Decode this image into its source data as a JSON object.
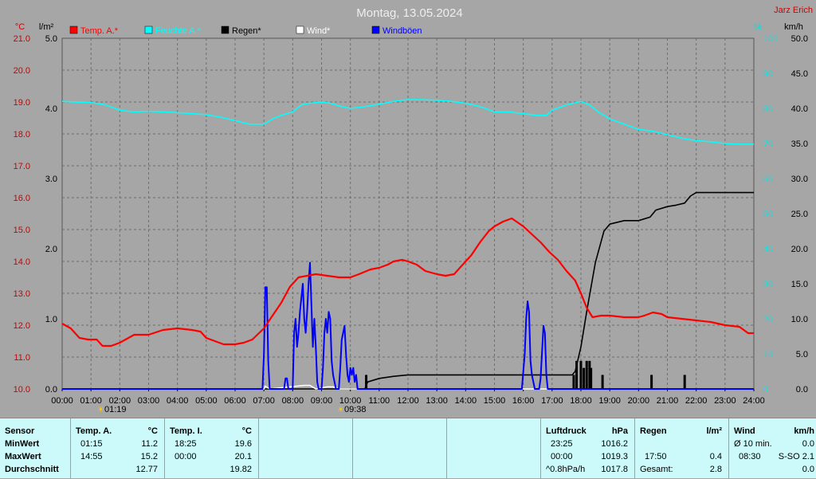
{
  "title": "Montag, 13.05.2024",
  "author": "Jarz Erich",
  "axes": {
    "temp_unit": "°C",
    "rain_unit": "l/m²",
    "humidity_unit": "%",
    "wind_unit": "km/h",
    "temp_ticks": [
      "21.0",
      "20.0",
      "19.0",
      "18.0",
      "17.0",
      "16.0",
      "15.0",
      "14.0",
      "13.0",
      "12.0",
      "11.0",
      "10.0"
    ],
    "rain_ticks": [
      "5.0",
      "4.0",
      "3.0",
      "2.0",
      "1.0",
      "0.0"
    ],
    "humidity_ticks": [
      "100",
      "90",
      "80",
      "70",
      "60",
      "50",
      "40",
      "30",
      "20",
      "10",
      "0"
    ],
    "wind_ticks": [
      "50.0",
      "45.0",
      "40.0",
      "35.0",
      "30.0",
      "25.0",
      "20.0",
      "15.0",
      "10.0",
      "5.0",
      "0.0"
    ],
    "time_ticks": [
      "00:00",
      "01:00",
      "02:00",
      "03:00",
      "04:00",
      "05:00",
      "06:00",
      "07:00",
      "08:00",
      "09:00",
      "10:00",
      "11:00",
      "12:00",
      "13:00",
      "14:00",
      "15:00",
      "16:00",
      "17:00",
      "18:00",
      "19:00",
      "20:00",
      "21:00",
      "22:00",
      "23:00",
      "24:00"
    ],
    "sunrise": "01:19",
    "sunset": "09:38"
  },
  "legend": [
    {
      "label": "Temp. A.*",
      "color": "#ff0000"
    },
    {
      "label": "Feuchte A.*",
      "color": "#00ffff"
    },
    {
      "label": "Regen*",
      "color": "#000000"
    },
    {
      "label": "Wind*",
      "color": "#ffffff"
    },
    {
      "label": "Windböen",
      "color": "#0000ff"
    }
  ],
  "chart_data": {
    "type": "line",
    "x_unit": "hours",
    "xlim": [
      0,
      24
    ],
    "series": [
      {
        "name": "Temp. A.*",
        "axis": "temp",
        "ylim": [
          10,
          21
        ],
        "color": "#ff0000",
        "points": [
          [
            0,
            12.05
          ],
          [
            0.3,
            11.9
          ],
          [
            0.6,
            11.6
          ],
          [
            0.9,
            11.55
          ],
          [
            1.2,
            11.55
          ],
          [
            1.4,
            11.35
          ],
          [
            1.7,
            11.35
          ],
          [
            2.0,
            11.45
          ],
          [
            2.3,
            11.6
          ],
          [
            2.5,
            11.7
          ],
          [
            3.0,
            11.7
          ],
          [
            3.5,
            11.85
          ],
          [
            4.0,
            11.9
          ],
          [
            4.5,
            11.85
          ],
          [
            4.8,
            11.8
          ],
          [
            5.0,
            11.6
          ],
          [
            5.3,
            11.5
          ],
          [
            5.6,
            11.4
          ],
          [
            6.0,
            11.4
          ],
          [
            6.3,
            11.45
          ],
          [
            6.6,
            11.55
          ],
          [
            7.0,
            11.9
          ],
          [
            7.3,
            12.3
          ],
          [
            7.6,
            12.7
          ],
          [
            7.9,
            13.2
          ],
          [
            8.2,
            13.5
          ],
          [
            8.5,
            13.55
          ],
          [
            8.8,
            13.6
          ],
          [
            9.2,
            13.55
          ],
          [
            9.6,
            13.5
          ],
          [
            10.0,
            13.5
          ],
          [
            10.3,
            13.6
          ],
          [
            10.7,
            13.75
          ],
          [
            11.0,
            13.8
          ],
          [
            11.3,
            13.9
          ],
          [
            11.5,
            14.0
          ],
          [
            11.8,
            14.05
          ],
          [
            12.0,
            14.0
          ],
          [
            12.3,
            13.9
          ],
          [
            12.6,
            13.7
          ],
          [
            13.0,
            13.6
          ],
          [
            13.3,
            13.55
          ],
          [
            13.6,
            13.6
          ],
          [
            13.9,
            13.9
          ],
          [
            14.2,
            14.2
          ],
          [
            14.5,
            14.6
          ],
          [
            14.8,
            14.95
          ],
          [
            15.0,
            15.1
          ],
          [
            15.3,
            15.25
          ],
          [
            15.6,
            15.35
          ],
          [
            16.0,
            15.1
          ],
          [
            16.3,
            14.85
          ],
          [
            16.6,
            14.6
          ],
          [
            16.9,
            14.3
          ],
          [
            17.2,
            14.05
          ],
          [
            17.5,
            13.7
          ],
          [
            17.8,
            13.4
          ],
          [
            18.0,
            13.0
          ],
          [
            18.2,
            12.55
          ],
          [
            18.4,
            12.25
          ],
          [
            18.7,
            12.3
          ],
          [
            19.0,
            12.3
          ],
          [
            19.5,
            12.25
          ],
          [
            20.0,
            12.25
          ],
          [
            20.2,
            12.3
          ],
          [
            20.5,
            12.4
          ],
          [
            20.8,
            12.35
          ],
          [
            21.0,
            12.25
          ],
          [
            21.5,
            12.2
          ],
          [
            22.0,
            12.15
          ],
          [
            22.5,
            12.1
          ],
          [
            23.0,
            12.0
          ],
          [
            23.5,
            11.95
          ],
          [
            23.8,
            11.75
          ],
          [
            24.0,
            11.75
          ]
        ]
      },
      {
        "name": "Feuchte A.*",
        "axis": "humidity",
        "ylim": [
          0,
          100
        ],
        "color": "#00ffff",
        "points": [
          [
            0,
            82.0
          ],
          [
            0.5,
            81.8
          ],
          [
            1.0,
            81.7
          ],
          [
            1.5,
            81.0
          ],
          [
            2.0,
            79.5
          ],
          [
            2.5,
            79.0
          ],
          [
            3.0,
            79.2
          ],
          [
            3.5,
            79.0
          ],
          [
            4.0,
            78.8
          ],
          [
            4.5,
            78.5
          ],
          [
            5.0,
            78.2
          ],
          [
            5.5,
            77.5
          ],
          [
            6.0,
            76.5
          ],
          [
            6.5,
            75.5
          ],
          [
            7.0,
            75.5
          ],
          [
            7.3,
            77.0
          ],
          [
            7.6,
            78.0
          ],
          [
            8.0,
            79.0
          ],
          [
            8.3,
            81.0
          ],
          [
            8.6,
            81.5
          ],
          [
            9.0,
            81.8
          ],
          [
            9.3,
            81.5
          ],
          [
            9.7,
            80.5
          ],
          [
            10.0,
            80.0
          ],
          [
            10.5,
            80.5
          ],
          [
            11.0,
            81.2
          ],
          [
            11.5,
            82.0
          ],
          [
            12.0,
            82.5
          ],
          [
            12.5,
            82.5
          ],
          [
            13.0,
            82.3
          ],
          [
            13.5,
            82.0
          ],
          [
            14.0,
            81.5
          ],
          [
            14.5,
            80.5
          ],
          [
            15.0,
            79.0
          ],
          [
            15.5,
            79.0
          ],
          [
            16.0,
            78.5
          ],
          [
            16.5,
            78.0
          ],
          [
            16.8,
            78.0
          ],
          [
            17.0,
            79.5
          ],
          [
            17.5,
            81.0
          ],
          [
            18.0,
            82.0
          ],
          [
            18.3,
            81.0
          ],
          [
            18.6,
            79.0
          ],
          [
            19.0,
            77.0
          ],
          [
            19.5,
            75.5
          ],
          [
            20.0,
            74.0
          ],
          [
            20.5,
            73.5
          ],
          [
            21.0,
            72.5
          ],
          [
            21.5,
            71.5
          ],
          [
            22.0,
            70.8
          ],
          [
            22.5,
            70.5
          ],
          [
            23.0,
            70.0
          ],
          [
            23.5,
            69.8
          ],
          [
            24.0,
            69.8
          ]
        ]
      },
      {
        "name": "Regen*",
        "axis": "rain",
        "ylim": [
          0,
          5
        ],
        "color": "#000000",
        "points": [
          [
            0,
            0
          ],
          [
            10.5,
            0
          ],
          [
            10.6,
            0.1
          ],
          [
            11.0,
            0.15
          ],
          [
            11.5,
            0.18
          ],
          [
            12.0,
            0.2
          ],
          [
            17.2,
            0.2
          ],
          [
            17.7,
            0.2
          ],
          [
            17.8,
            0.25
          ],
          [
            18.0,
            0.6
          ],
          [
            18.2,
            1.1
          ],
          [
            18.5,
            1.8
          ],
          [
            18.8,
            2.25
          ],
          [
            19.0,
            2.35
          ],
          [
            19.5,
            2.4
          ],
          [
            20.0,
            2.4
          ],
          [
            20.4,
            2.45
          ],
          [
            20.6,
            2.55
          ],
          [
            21.0,
            2.6
          ],
          [
            21.3,
            2.62
          ],
          [
            21.6,
            2.65
          ],
          [
            21.8,
            2.75
          ],
          [
            22.0,
            2.8
          ],
          [
            22.5,
            2.8
          ],
          [
            23.0,
            2.8
          ],
          [
            24.0,
            2.8
          ]
        ]
      },
      {
        "name": "Regen-Balken",
        "axis": "rain",
        "ylim": [
          0,
          5
        ],
        "color": "#000000",
        "bars": [
          [
            10.55,
            0.2
          ],
          [
            17.75,
            0.2
          ],
          [
            17.85,
            0.4
          ],
          [
            18.0,
            0.4
          ],
          [
            18.1,
            0.3
          ],
          [
            18.2,
            0.4
          ],
          [
            18.3,
            0.4
          ],
          [
            18.35,
            0.3
          ],
          [
            18.75,
            0.2
          ],
          [
            20.45,
            0.2
          ],
          [
            21.6,
            0.2
          ]
        ]
      },
      {
        "name": "Windböen",
        "axis": "wind",
        "ylim": [
          0,
          50
        ],
        "color": "#0000ff",
        "points": [
          [
            0,
            0
          ],
          [
            6.95,
            0
          ],
          [
            7.0,
            5
          ],
          [
            7.05,
            14.5
          ],
          [
            7.1,
            14.5
          ],
          [
            7.15,
            4
          ],
          [
            7.2,
            0
          ],
          [
            7.7,
            0
          ],
          [
            7.75,
            1.5
          ],
          [
            7.8,
            1.5
          ],
          [
            7.85,
            0
          ],
          [
            8.0,
            0
          ],
          [
            8.05,
            8
          ],
          [
            8.1,
            10
          ],
          [
            8.15,
            6
          ],
          [
            8.2,
            8
          ],
          [
            8.25,
            11
          ],
          [
            8.3,
            13
          ],
          [
            8.35,
            15
          ],
          [
            8.4,
            10
          ],
          [
            8.45,
            8
          ],
          [
            8.5,
            11
          ],
          [
            8.55,
            15
          ],
          [
            8.6,
            18
          ],
          [
            8.65,
            12
          ],
          [
            8.7,
            6
          ],
          [
            8.75,
            10
          ],
          [
            8.8,
            6
          ],
          [
            8.85,
            1
          ],
          [
            8.9,
            0
          ],
          [
            9.0,
            0
          ],
          [
            9.05,
            3
          ],
          [
            9.1,
            8
          ],
          [
            9.15,
            10
          ],
          [
            9.2,
            8
          ],
          [
            9.25,
            11
          ],
          [
            9.3,
            10
          ],
          [
            9.35,
            4
          ],
          [
            9.4,
            2
          ],
          [
            9.45,
            1
          ],
          [
            9.5,
            0
          ],
          [
            9.6,
            0
          ],
          [
            9.65,
            3
          ],
          [
            9.7,
            7
          ],
          [
            9.75,
            8
          ],
          [
            9.8,
            9
          ],
          [
            9.85,
            5
          ],
          [
            9.9,
            2
          ],
          [
            9.95,
            1
          ],
          [
            10.0,
            3
          ],
          [
            10.05,
            2
          ],
          [
            10.1,
            3
          ],
          [
            10.15,
            1
          ],
          [
            10.2,
            2
          ],
          [
            10.25,
            0
          ],
          [
            15.95,
            0
          ],
          [
            16.05,
            5
          ],
          [
            16.1,
            10
          ],
          [
            16.15,
            12.5
          ],
          [
            16.2,
            11
          ],
          [
            16.25,
            4
          ],
          [
            16.3,
            2
          ],
          [
            16.35,
            1
          ],
          [
            16.4,
            0
          ],
          [
            16.55,
            0
          ],
          [
            16.6,
            1.5
          ],
          [
            16.7,
            9
          ],
          [
            16.75,
            8
          ],
          [
            16.8,
            2
          ],
          [
            16.85,
            0
          ],
          [
            24.0,
            0
          ]
        ]
      },
      {
        "name": "Wind*",
        "axis": "wind",
        "ylim": [
          0,
          50
        ],
        "color": "#ffffff",
        "points": [
          [
            0,
            0
          ],
          [
            7.0,
            0
          ],
          [
            7.05,
            0.4
          ],
          [
            7.2,
            0
          ],
          [
            8.4,
            0.5
          ],
          [
            8.6,
            0.5
          ],
          [
            8.8,
            0
          ],
          [
            9.2,
            0.3
          ],
          [
            9.4,
            0.3
          ],
          [
            9.6,
            0
          ],
          [
            24,
            0
          ]
        ]
      }
    ]
  },
  "panel": {
    "sensor": {
      "header": "Sensor",
      "rows": [
        "MinWert",
        "MaxWert",
        "Durchschnitt"
      ]
    },
    "temp_a": {
      "header": "Temp. A.",
      "unit": "°C",
      "rows": [
        [
          "01:15",
          "11.2"
        ],
        [
          "14:55",
          "15.2"
        ],
        [
          "",
          "12.77"
        ]
      ]
    },
    "temp_i": {
      "header": "Temp. I.",
      "unit": "°C",
      "rows": [
        [
          "18:25",
          "19.6"
        ],
        [
          "00:00",
          "20.1"
        ],
        [
          "",
          "19.82"
        ]
      ]
    },
    "druck": {
      "header": "Luftdruck",
      "unit": "hPa",
      "rows": [
        [
          "23:25",
          "1016.2"
        ],
        [
          "00:00",
          "1019.3"
        ],
        [
          "^0.8hPa/h",
          "1017.8"
        ]
      ]
    },
    "regen": {
      "header": "Regen",
      "unit": "l/m²",
      "rows": [
        [
          "",
          ""
        ],
        [
          "17:50",
          "0.4"
        ],
        [
          "Gesamt:",
          "2.8"
        ]
      ]
    },
    "wind": {
      "header": "Wind",
      "unit": "km/h",
      "rows": [
        [
          "Ø 10 min.",
          "0.0"
        ],
        [
          "08:30",
          "S-SO 2.1"
        ],
        [
          "",
          "0.0"
        ]
      ]
    }
  },
  "colors": {
    "background": "#a6a6a6",
    "panel": "#ccfafa",
    "grid": "#6e6e6e"
  }
}
